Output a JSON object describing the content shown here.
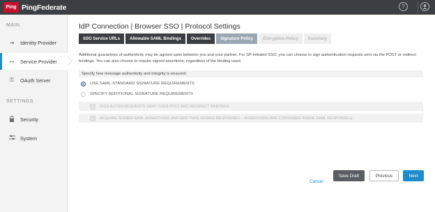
{
  "brand": {
    "logo_mark": "Ping",
    "logo_text": "PingFederate"
  },
  "topbar": {
    "help_icon": "?",
    "user_icon": "user-circle"
  },
  "sidebar": {
    "main_label": "MAIN",
    "settings_label": "SETTINGS",
    "items": [
      {
        "label": "Identity Provider",
        "icon": "arrow-in-icon"
      },
      {
        "label": "Service Provider",
        "icon": "arrow-out-icon",
        "active": true
      },
      {
        "label": "OAuth Server",
        "icon": "key-icon"
      },
      {
        "label": "Security",
        "icon": "lock-icon"
      },
      {
        "label": "System",
        "icon": "sliders-icon"
      }
    ]
  },
  "page": {
    "title": "IdP Connection | Browser SSO | Protocol Settings",
    "tabs": [
      {
        "label": "SSO Service URLs",
        "state": "done"
      },
      {
        "label": "Allowable SAML Bindings",
        "state": "done"
      },
      {
        "label": "Overrides",
        "state": "done"
      },
      {
        "label": "Signature Policy",
        "state": "current"
      },
      {
        "label": "Encryption Policy",
        "state": "future"
      },
      {
        "label": "Summary",
        "state": "future"
      }
    ],
    "description": "Additional guarantees of authenticity may be agreed upon between you and your partner. For SP-initiated SSO, you can choose to sign authentication requests sent via the POST or redirect bindings. You can also choose to require signed assertions, regardless of the binding used.",
    "instruction": "Specify how message authenticity and integrity is ensured:",
    "options": {
      "standard": "USE SAML-STANDARD SIGNATURE REQUIREMENTS",
      "additional": "SPECIFY ADDITIONAL SIGNATURE REQUIREMENTS"
    },
    "checkboxes": {
      "sign_authn": "SIGN AUTHN REQUESTS SENT OVER POST AND REDIRECT BINDINGS",
      "require_signed": "REQUIRE SIGNED SAML ASSERTIONS (RATHER THAN SIGNED RESPONSES -- ASSERTIONS ARE CONTAINED INSIDE SAML RESPONSES)"
    }
  },
  "actions": {
    "cancel": "Cancel",
    "save_draft": "Save Draft",
    "previous": "Previous",
    "next": "Next"
  },
  "colors": {
    "topbar": "#3b3e42",
    "accent": "#1e8ccc",
    "brand_red": "#c8102e",
    "tab_done": "#3b3e42",
    "tab_current": "#9aa6b1"
  }
}
